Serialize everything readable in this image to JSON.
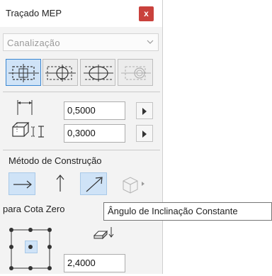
{
  "window": {
    "title": "Traçado MEP",
    "close_label": "x"
  },
  "system_dropdown": {
    "value": "Canalização"
  },
  "dimensions": {
    "width_value": "0,5000",
    "height_value": "0,3000",
    "elevation_value": "2,4000"
  },
  "construction_method": {
    "label": "Método de Construção"
  },
  "reference": {
    "label": "para Cota Zero"
  },
  "tooltip": {
    "text": "Ângulo de Inclinação Constante"
  },
  "colors": {
    "accent": "#3a86d1",
    "active_fill": "#cfe3f7",
    "close_button": "#c9413c"
  }
}
